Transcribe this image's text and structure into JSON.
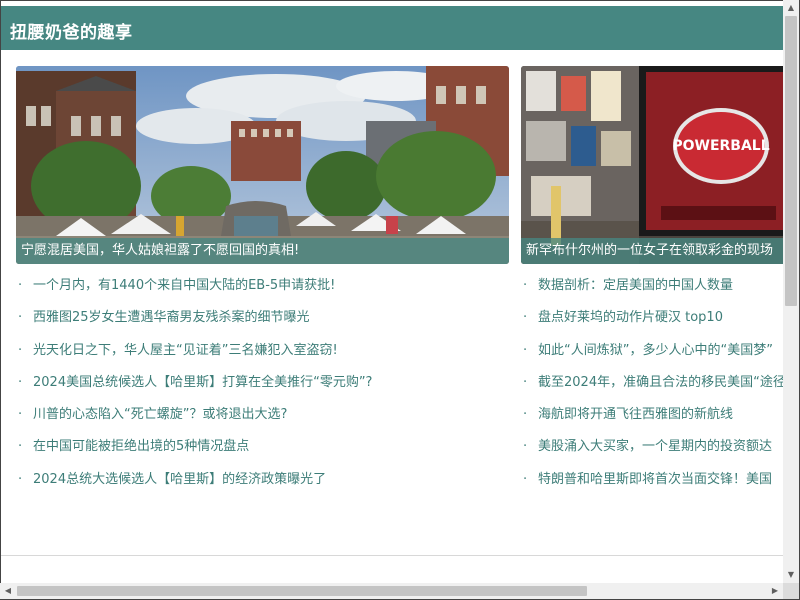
{
  "header": {
    "title": "扭腰奶爸的趣享"
  },
  "featured": [
    {
      "caption": "宁愿混居美国，华人姑娘袒露了不愿回国的真相!"
    },
    {
      "caption": "新罕布什尔州的一位女子在领取彩金的现场"
    }
  ],
  "lists": {
    "left": [
      "一个月内，有1440个来自中国大陆的EB-5申请获批!",
      "西雅图25岁女生遭遇华裔男友残杀案的细节曝光",
      "光天化日之下，华人屋主“见证着”三名嫌犯入室盗窃!",
      "2024美国总统候选人【哈里斯】打算在全美推行“零元购”?",
      "川普的心态陷入“死亡螺旋”？或将退出大选?",
      "在中国可能被拒绝出境的5种情况盘点",
      "2024总统大选候选人【哈里斯】的经济政策曝光了"
    ],
    "right": [
      "数据剖析：定居美国的中国人数量",
      "盘点好莱坞的动作片硬汉 top10",
      "如此“人间炼狱”，多少人心中的“美国梦”",
      "截至2024年，准确且合法的移民美国“途径”",
      "海航即将开通飞往西雅图的新航线",
      "美股涌入大买家，一个星期内的投资额达",
      "特朗普和哈里斯即将首次当面交锋！美国"
    ]
  },
  "bullet": "·",
  "sign_text": "POWERBALL",
  "colors": {
    "header_bg": "#468782",
    "link": "#3d7d78"
  }
}
